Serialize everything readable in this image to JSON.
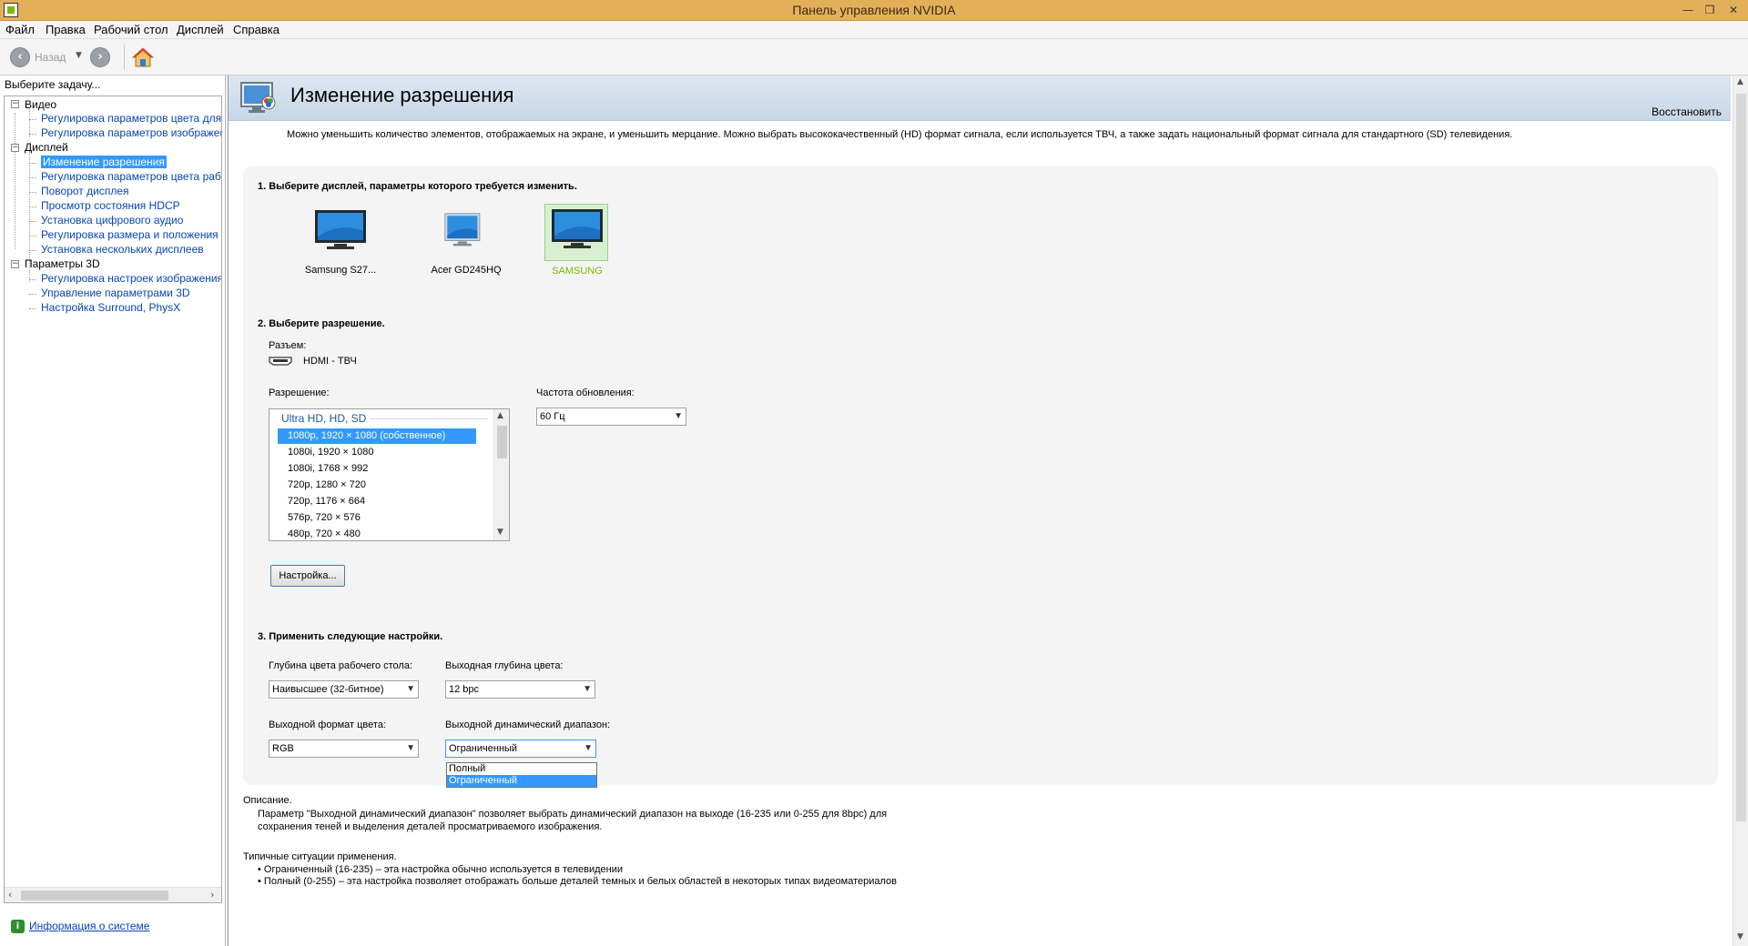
{
  "window": {
    "title": "Панель управления NVIDIA",
    "minimize": "—",
    "maximize": "❐",
    "close": "✕"
  },
  "menu": [
    "Файл",
    "Правка",
    "Рабочий стол",
    "Дисплей",
    "Справка"
  ],
  "toolbar": {
    "back_label": "Назад"
  },
  "left": {
    "task_label": "Выберите задачу...",
    "tree": [
      {
        "label": "Видео",
        "kind": "cat"
      },
      {
        "label": "Регулировка параметров цвета для видео",
        "kind": "link"
      },
      {
        "label": "Регулировка параметров изображения для видео",
        "kind": "link"
      },
      {
        "label": "Дисплей",
        "kind": "cat"
      },
      {
        "label": "Изменение разрешения",
        "kind": "sel"
      },
      {
        "label": "Регулировка параметров цвета рабочего стола",
        "kind": "link"
      },
      {
        "label": "Поворот дисплея",
        "kind": "link"
      },
      {
        "label": "Просмотр состояния HDCP",
        "kind": "link"
      },
      {
        "label": "Установка цифрового аудио",
        "kind": "link"
      },
      {
        "label": "Регулировка размера и положения рабочего стола",
        "kind": "link"
      },
      {
        "label": "Установка нескольких дисплеев",
        "kind": "link"
      },
      {
        "label": "Параметры 3D",
        "kind": "cat"
      },
      {
        "label": "Регулировка настроек изображения с просмотром",
        "kind": "link"
      },
      {
        "label": "Управление параметрами 3D",
        "kind": "link"
      },
      {
        "label": "Настройка Surround, PhysX",
        "kind": "link"
      }
    ],
    "sysinfo": "Информация о системе"
  },
  "main": {
    "title": "Изменение разрешения",
    "restore": "Восстановить",
    "intro": "Можно уменьшить количество элементов, отображаемых на экране, и уменьшить мерцание. Можно выбрать высококачественный (HD) формат сигнала, если используется ТВЧ, а также задать национальный формат сигнала для стандартного (SD) телевидения.",
    "step1": "1. Выберите дисплей, параметры которого требуется изменить.",
    "displays": [
      {
        "name": "Samsung S27...",
        "selected": false
      },
      {
        "name": "Acer GD245HQ",
        "selected": false
      },
      {
        "name": "SAMSUNG",
        "selected": true
      }
    ],
    "selected_display_color": "#76b900",
    "step2": "2. Выберите разрешение.",
    "connector_label": "Разъем:",
    "connector_value": "HDMI - ТВЧ",
    "resolution_label": "Разрешение:",
    "resolution_group": "Ultra HD, HD, SD",
    "resolutions": [
      "1080p, 1920 × 1080 (собственное)",
      "1080i, 1920 × 1080",
      "1080i, 1768 × 992",
      "720p, 1280 × 720",
      "720p, 1176 × 664",
      "576p, 720 × 576",
      "480p, 720 × 480"
    ],
    "refresh_label": "Частота обновления:",
    "refresh_value": "60 Гц",
    "customize_button": "Настройка...",
    "step3": "3. Применить следующие настройки.",
    "desktop_depth_label": "Глубина цвета рабочего стола:",
    "desktop_depth_value": "Наивысшее (32-битное)",
    "output_depth_label": "Выходная глубина цвета:",
    "output_depth_value": "12 bpc",
    "output_format_label": "Выходной формат цвета:",
    "output_format_value": "RGB",
    "dynamic_range_label": "Выходной динамический диапазон:",
    "dynamic_range_value": "Ограниченный",
    "dynamic_range_options": [
      "Полный",
      "Ограниченный"
    ],
    "description_title": "Описание.",
    "description_line1": "Параметр \"Выходной динамический диапазон\" позволяет выбрать динамический диапазон на выходе (16-235 или 0-255 для 8bpc) для",
    "description_line2": "сохранения теней и выделения деталей просматриваемого изображения.",
    "usage_title": "Типичные ситуации применения.",
    "usage_1": "• Ограниченный (16-235) – эта настройка обычно используется в телевидении",
    "usage_2": "• Полный (0-255) – эта настройка позволяет отображать больше деталей темных и белых областей в некоторых типах видеоматериалов"
  }
}
